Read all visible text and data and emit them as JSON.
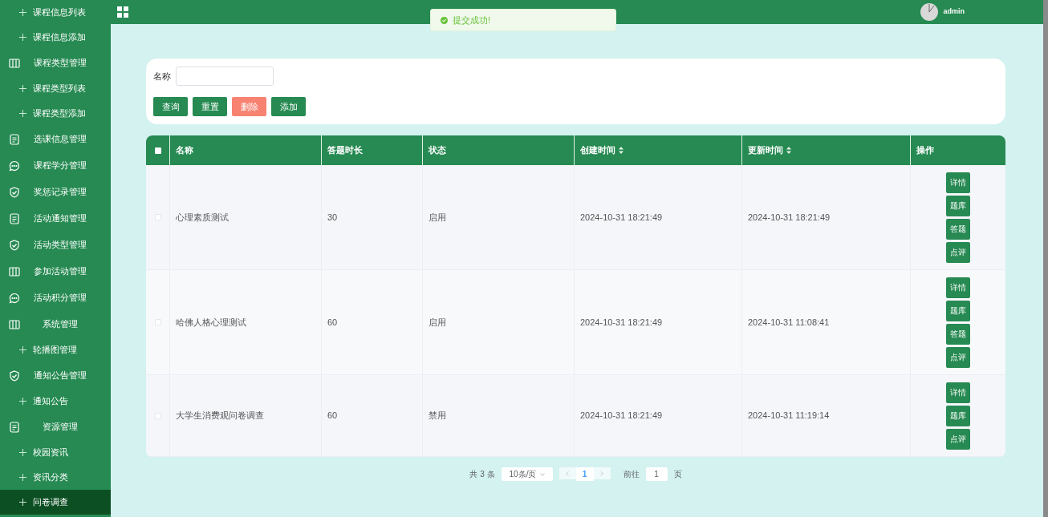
{
  "sidebar": {
    "items": [
      {
        "kind": "plus",
        "label": "课程信息列表",
        "selected": false
      },
      {
        "kind": "plus",
        "label": "课程信息添加",
        "selected": false
      },
      {
        "kind": "columns",
        "label": "课程类型管理",
        "selected": false
      },
      {
        "kind": "plus",
        "label": "课程类型列表",
        "selected": false
      },
      {
        "kind": "plus",
        "label": "课程类型添加",
        "selected": false
      },
      {
        "kind": "document",
        "label": "选课信息管理",
        "selected": false
      },
      {
        "kind": "chat",
        "label": "课程学分管理",
        "selected": false
      },
      {
        "kind": "shield",
        "label": "奖惩记录管理",
        "selected": false
      },
      {
        "kind": "document",
        "label": "活动通知管理",
        "selected": false
      },
      {
        "kind": "shield",
        "label": "活动类型管理",
        "selected": false
      },
      {
        "kind": "columns",
        "label": "参加活动管理",
        "selected": false
      },
      {
        "kind": "chat",
        "label": "活动积分管理",
        "selected": false
      },
      {
        "kind": "columns",
        "label": "系统管理",
        "selected": false
      },
      {
        "kind": "plus",
        "label": "轮播图管理",
        "selected": false
      },
      {
        "kind": "shield",
        "label": "通知公告管理",
        "selected": false
      },
      {
        "kind": "plus",
        "label": "通知公告",
        "selected": false
      },
      {
        "kind": "document",
        "label": "资源管理",
        "selected": false
      },
      {
        "kind": "plus",
        "label": "校园资讯",
        "selected": false
      },
      {
        "kind": "plus",
        "label": "资讯分类",
        "selected": false
      },
      {
        "kind": "plus",
        "label": "问卷调查",
        "selected": true
      }
    ]
  },
  "header": {
    "user": "admin"
  },
  "toast": {
    "message": "提交成功!"
  },
  "filter": {
    "label": "名称",
    "buttons": [
      {
        "kind": "primary",
        "label": "查询"
      },
      {
        "kind": "primary",
        "label": "重置"
      },
      {
        "kind": "danger",
        "label": "删除"
      },
      {
        "kind": "primary",
        "label": "添加"
      }
    ]
  },
  "table": {
    "all_checked": false,
    "columns": [
      {
        "label": "名称",
        "sortable": false
      },
      {
        "label": "答题时长",
        "sortable": false
      },
      {
        "label": "状态",
        "sortable": false
      },
      {
        "label": "创建时间",
        "sortable": true
      },
      {
        "label": "更新时间",
        "sortable": true
      },
      {
        "label": "操作",
        "sortable": false
      }
    ],
    "rows": [
      {
        "checked": false,
        "cells": [
          "心理素质测试",
          "30",
          "启用",
          "2024-10-31 18:21:49",
          "2024-10-31 18:21:49"
        ],
        "actions": [
          "详情",
          "题库",
          "答题",
          "点评"
        ]
      },
      {
        "checked": false,
        "cells": [
          "哈佛人格心理测试",
          "60",
          "启用",
          "2024-10-31 18:21:49",
          "2024-10-31 11:08:41"
        ],
        "actions": [
          "详情",
          "题库",
          "答题",
          "点评"
        ]
      },
      {
        "checked": false,
        "cells": [
          "大学生消费观问卷调查",
          "60",
          "禁用",
          "2024-10-31 18:21:49",
          "2024-10-31 11:19:14"
        ],
        "actions": [
          "详情",
          "题库",
          "点评"
        ]
      }
    ]
  },
  "pagination": {
    "total": "共 3 条",
    "page_size": "10条/页",
    "pages": [
      {
        "label": "1",
        "selected": true
      }
    ],
    "goto_label": "前往",
    "goto_value": "1",
    "goto_suffix": "页"
  }
}
